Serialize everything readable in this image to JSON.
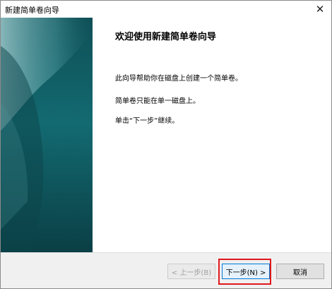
{
  "window": {
    "title": "新建简单卷向导",
    "close_symbol": "✕"
  },
  "wizard": {
    "heading": "欢迎使用新建简单卷向导",
    "paragraphs": [
      "此向导帮助你在磁盘上创建一个简单卷。",
      "简单卷只能在单一磁盘上。",
      "单击“下一步”继续。"
    ]
  },
  "buttons": {
    "back_label": "< 上一步(B)",
    "next_label": "下一步(N) >",
    "cancel_label": "取消"
  },
  "colors": {
    "side_panel_dark": "#0f4f56",
    "side_panel_light": "#7fb6b9",
    "highlight_border": "#e0181d",
    "accent_border": "#0078d7"
  },
  "icons": {
    "close": "close-icon"
  }
}
